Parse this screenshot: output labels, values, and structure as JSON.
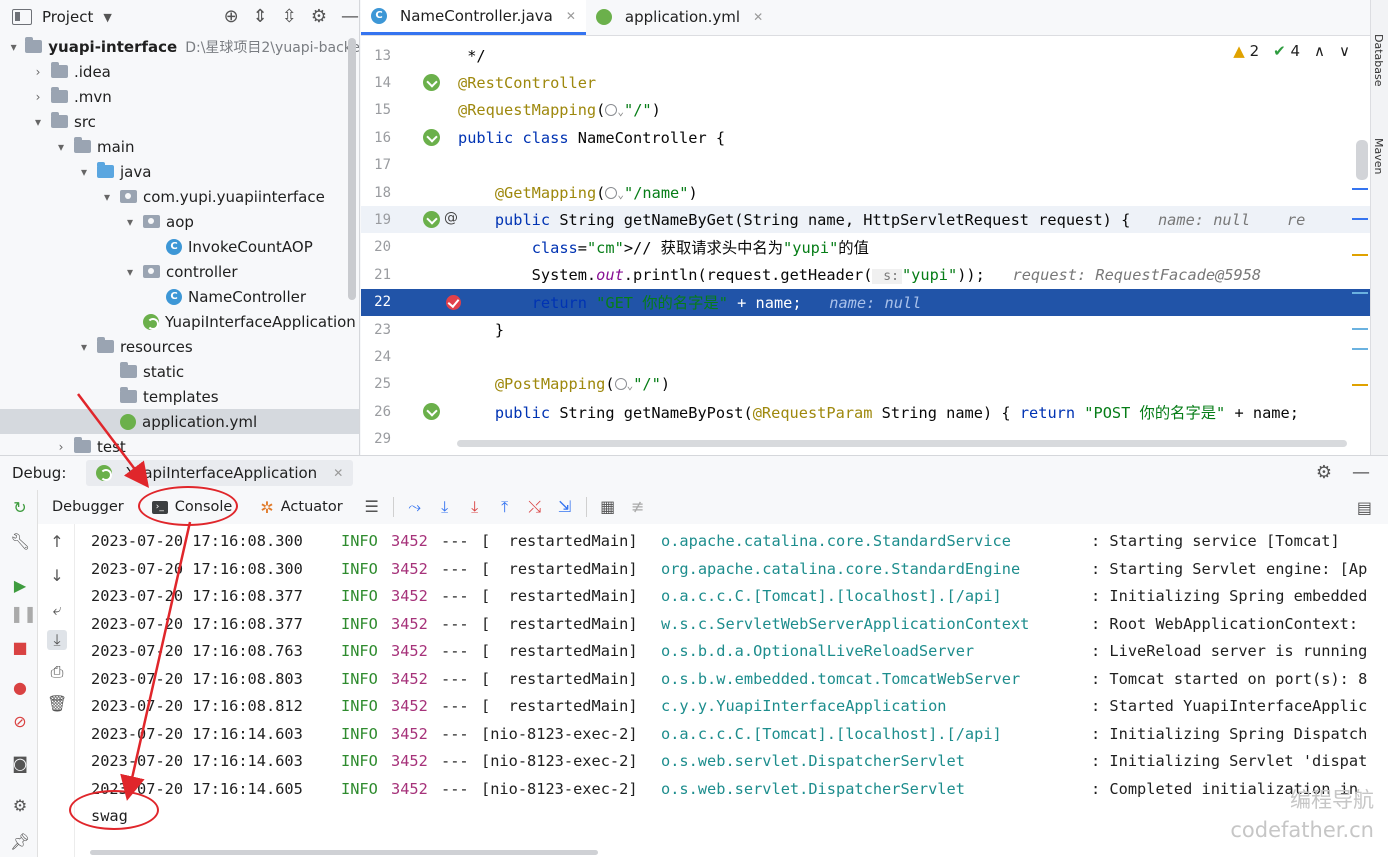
{
  "project": {
    "title": "Project",
    "tree": [
      {
        "label": "yuapi-interface",
        "path": "D:\\星球项目2\\yuapi-backe",
        "arrow": "▾",
        "icon": "folder",
        "indent": 0
      },
      {
        "label": ".idea",
        "arrow": "›",
        "icon": "folder",
        "indent": 1
      },
      {
        "label": ".mvn",
        "arrow": "›",
        "icon": "folder",
        "indent": 1
      },
      {
        "label": "src",
        "arrow": "▾",
        "icon": "folder",
        "indent": 1
      },
      {
        "label": "main",
        "arrow": "▾",
        "icon": "folder",
        "indent": 2
      },
      {
        "label": "java",
        "arrow": "▾",
        "icon": "folder-blue",
        "indent": 3
      },
      {
        "label": "com.yupi.yuapiinterface",
        "arrow": "▾",
        "icon": "package",
        "indent": 4
      },
      {
        "label": "aop",
        "arrow": "▾",
        "icon": "package",
        "indent": 5
      },
      {
        "label": "InvokeCountAOP",
        "arrow": "",
        "icon": "class",
        "indent": 6
      },
      {
        "label": "controller",
        "arrow": "▾",
        "icon": "package",
        "indent": 5
      },
      {
        "label": "NameController",
        "arrow": "",
        "icon": "class",
        "indent": 6
      },
      {
        "label": "YuapiInterfaceApplication",
        "arrow": "",
        "icon": "spring-class",
        "indent": 5
      },
      {
        "label": "resources",
        "arrow": "▾",
        "icon": "folder-res",
        "indent": 3
      },
      {
        "label": "static",
        "arrow": "",
        "icon": "folder",
        "indent": 4
      },
      {
        "label": "templates",
        "arrow": "",
        "icon": "folder",
        "indent": 4
      },
      {
        "label": "application.yml",
        "arrow": "",
        "icon": "yml",
        "indent": 4,
        "selected": true
      },
      {
        "label": "test",
        "arrow": "›",
        "icon": "folder",
        "indent": 2
      }
    ]
  },
  "editor": {
    "tabs": [
      {
        "label": "NameController.java",
        "icon": "class-icon",
        "active": true
      },
      {
        "label": "application.yml",
        "icon": "yml-icon",
        "active": false
      }
    ],
    "inspections": {
      "warnings": "2",
      "ok": "4"
    },
    "lines": [
      {
        "no": "13",
        "text": " */",
        "gutter": ""
      },
      {
        "no": "14",
        "text": "@RestController",
        "gutter": "bean"
      },
      {
        "no": "15",
        "text": "@RequestMapping(",
        "after": "\"/\")",
        "gutter": ""
      },
      {
        "no": "16",
        "text": "public class NameController {",
        "gutter": "bean"
      },
      {
        "no": "17",
        "text": "",
        "gutter": ""
      },
      {
        "no": "18",
        "text": "    @GetMapping(",
        "after": "\"/name\")",
        "gutter": ""
      },
      {
        "no": "19",
        "text": "    public String getNameByGet(String name, HttpServletRequest request) {",
        "hint": "name: null",
        "hint2": "re",
        "gutter": "bean-at"
      },
      {
        "no": "20",
        "text": "        // 获取请求头中名为\"yupi\"的值",
        "gutter": ""
      },
      {
        "no": "21",
        "text": "        System.out.println(request.getHeader(",
        "param": "s:",
        "after": "\"yupi\"));",
        "hint": "request: RequestFacade@5958",
        "gutter": ""
      },
      {
        "no": "22",
        "text": "        return \"GET 你的名字是\" + name;",
        "hint": "name: null",
        "gutter": "breakpoint"
      },
      {
        "no": "23",
        "text": "    }",
        "gutter": ""
      },
      {
        "no": "24",
        "text": "",
        "gutter": ""
      },
      {
        "no": "25",
        "text": "    @PostMapping(",
        "after": "\"/\")",
        "gutter": ""
      },
      {
        "no": "26",
        "text": "    public String getNameByPost(@RequestParam String name) { return \"POST 你的名字是\" + name;",
        "gutter": "bean"
      },
      {
        "no": "29",
        "text": "",
        "gutter": ""
      }
    ]
  },
  "right_strip": {
    "database": "Database",
    "maven": "Maven"
  },
  "debug": {
    "title": "Debug:",
    "session": "YuapiInterfaceApplication",
    "tabs": {
      "debugger": "Debugger",
      "console": "Console",
      "actuator": "Actuator"
    },
    "logs": [
      {
        "ts": "2023-07-20 17:16:08.300",
        "lvl": "INFO",
        "pid": "3452",
        "sep": "---",
        "thread": "[  restartedMain]",
        "logger": "o.apache.catalina.core.StandardService",
        "msg": ": Starting service [Tomcat]"
      },
      {
        "ts": "2023-07-20 17:16:08.300",
        "lvl": "INFO",
        "pid": "3452",
        "sep": "---",
        "thread": "[  restartedMain]",
        "logger": "org.apache.catalina.core.StandardEngine",
        "msg": ": Starting Servlet engine: [Ap"
      },
      {
        "ts": "2023-07-20 17:16:08.377",
        "lvl": "INFO",
        "pid": "3452",
        "sep": "---",
        "thread": "[  restartedMain]",
        "logger": "o.a.c.c.C.[Tomcat].[localhost].[/api]",
        "msg": ": Initializing Spring embedded"
      },
      {
        "ts": "2023-07-20 17:16:08.377",
        "lvl": "INFO",
        "pid": "3452",
        "sep": "---",
        "thread": "[  restartedMain]",
        "logger": "w.s.c.ServletWebServerApplicationContext",
        "msg": ": Root WebApplicationContext:"
      },
      {
        "ts": "2023-07-20 17:16:08.763",
        "lvl": "INFO",
        "pid": "3452",
        "sep": "---",
        "thread": "[  restartedMain]",
        "logger": "o.s.b.d.a.OptionalLiveReloadServer",
        "msg": ": LiveReload server is running"
      },
      {
        "ts": "2023-07-20 17:16:08.803",
        "lvl": "INFO",
        "pid": "3452",
        "sep": "---",
        "thread": "[  restartedMain]",
        "logger": "o.s.b.w.embedded.tomcat.TomcatWebServer",
        "msg": ": Tomcat started on port(s): 8"
      },
      {
        "ts": "2023-07-20 17:16:08.812",
        "lvl": "INFO",
        "pid": "3452",
        "sep": "---",
        "thread": "[  restartedMain]",
        "logger": "c.y.y.YuapiInterfaceApplication",
        "msg": ": Started YuapiInterfaceApplic"
      },
      {
        "ts": "2023-07-20 17:16:14.603",
        "lvl": "INFO",
        "pid": "3452",
        "sep": "---",
        "thread": "[nio-8123-exec-2]",
        "logger": "o.a.c.c.C.[Tomcat].[localhost].[/api]",
        "msg": ": Initializing Spring Dispatch"
      },
      {
        "ts": "2023-07-20 17:16:14.603",
        "lvl": "INFO",
        "pid": "3452",
        "sep": "---",
        "thread": "[nio-8123-exec-2]",
        "logger": "o.s.web.servlet.DispatcherServlet",
        "msg": ": Initializing Servlet 'dispat"
      },
      {
        "ts": "2023-07-20 17:16:14.605",
        "lvl": "INFO",
        "pid": "3452",
        "sep": "---",
        "thread": "[nio-8123-exec-2]",
        "logger": "o.s.web.servlet.DispatcherServlet",
        "msg": ": Completed initialization in"
      }
    ],
    "output": "swag"
  },
  "watermark": {
    "line1": "编程导航",
    "line2": "codefather.cn"
  },
  "colors": {
    "accent": "#3574f0",
    "exec_line": "#2154a8",
    "annotation_red": "#e0262b"
  }
}
